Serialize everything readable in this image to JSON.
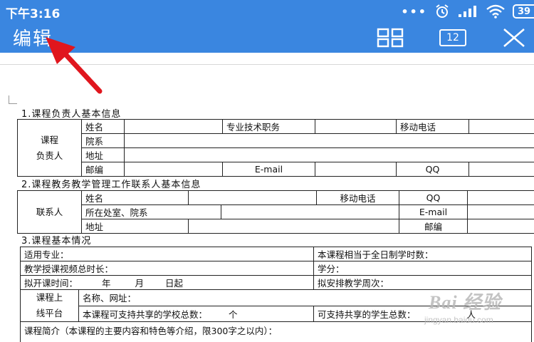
{
  "status_bar": {
    "time": "下午3:16",
    "dots": "•••",
    "battery": "39"
  },
  "app_bar": {
    "title": "编辑",
    "page_number": "12"
  },
  "sections": {
    "s1": "1.课程负责人基本信息",
    "s2": "2.课程教务教学管理工作联系人基本信息",
    "s3": "3.课程基本情况"
  },
  "table1": {
    "rowhead": [
      "课程",
      "负责人"
    ],
    "name": "姓名",
    "title": "专业技术职务",
    "mobile": "移动电话",
    "dept": "院系",
    "address": "地址",
    "postcode": "邮编",
    "email": "E-mail",
    "qq": "QQ"
  },
  "table2": {
    "rowhead": "联系人",
    "name": "姓名",
    "mobile": "移动电话",
    "qq": "QQ",
    "office": "所在处室、院系",
    "email": "E-mail",
    "address": "地址",
    "postcode": "邮编"
  },
  "table3": {
    "major": "适用专业：",
    "fulltime_hours": "本课程相当于全日制学时数：",
    "video_hours": "教学授课视频总时长：",
    "credits": "学分：",
    "start_time": "拟开课时间：",
    "year": "年",
    "month": "月",
    "day": "日起",
    "weeks": "拟安排教学周次：",
    "platform_head": [
      "课程上",
      "线平台"
    ],
    "platform_name": "名称、网址：",
    "schools": "本课程可支持共享的学校总数：",
    "unit_ge": "个",
    "students": "可支持共享的学生总数：",
    "unit_ren": "人",
    "intro": "课程简介（本课程的主要内容和特色等介绍，限300字之以内）："
  },
  "watermark": {
    "brand": "Bai 经验",
    "url": "jingyan.baidu.com"
  }
}
